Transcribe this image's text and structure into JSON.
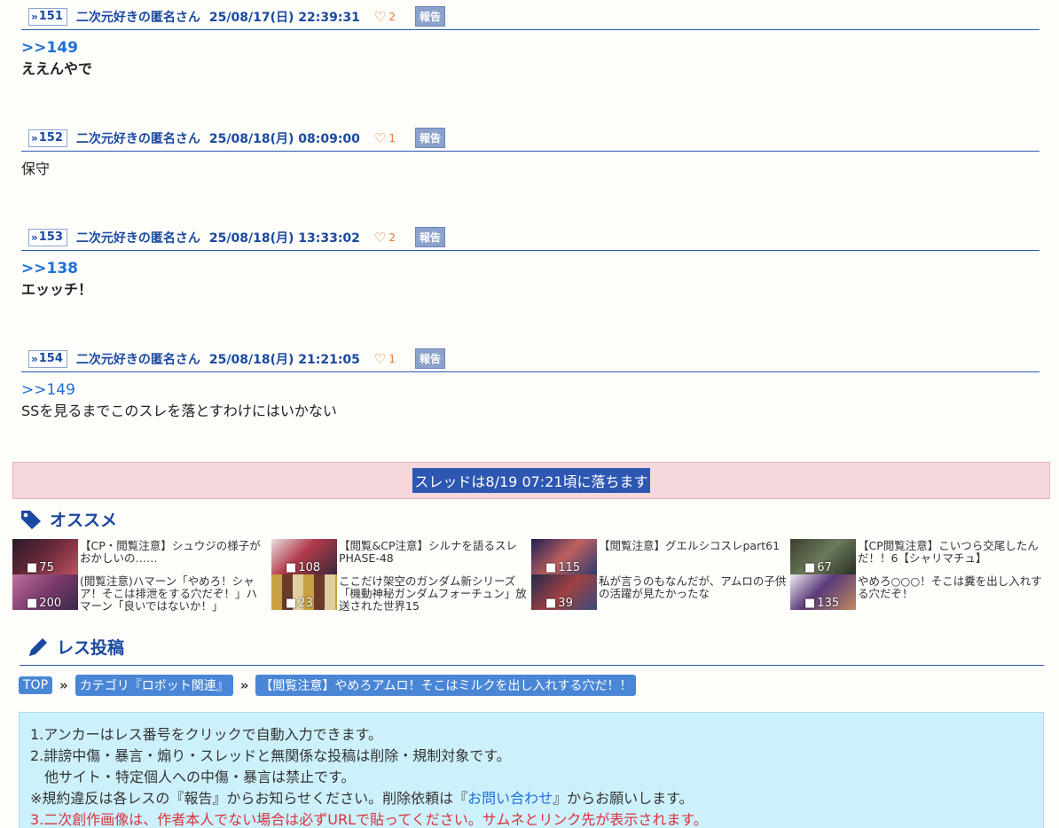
{
  "posts": [
    {
      "num": "151",
      "author": "二次元好きの匿名さん",
      "date": "25/08/17(日) 22:39:31",
      "likes": "2",
      "report": "報告",
      "anchor": ">>149",
      "text": "ええんやで"
    },
    {
      "num": "152",
      "author": "二次元好きの匿名さん",
      "date": "25/08/18(月) 08:09:00",
      "likes": "1",
      "report": "報告",
      "text": "保守"
    },
    {
      "num": "153",
      "author": "二次元好きの匿名さん",
      "date": "25/08/18(月) 13:33:02",
      "likes": "2",
      "report": "報告",
      "anchor": ">>138",
      "text": "エッッチ！"
    },
    {
      "num": "154",
      "author": "二次元好きの匿名さん",
      "date": "25/08/18(月) 21:21:05",
      "likes": "1",
      "report": "報告",
      "anchor": ">>149",
      "text": "SSを見るまでこのスレを落とすわけにはいかない"
    }
  ],
  "thread_end": "スレッドは8/19 07:21頃に落ちます",
  "recommend": {
    "title": "オススメ",
    "items": [
      {
        "count": "75",
        "title": "【CP・閲覧注意】シュウジの様子がおかしいの……",
        "color": "#6b2a3a"
      },
      {
        "count": "108",
        "title": "【閲覧&CP注意】シルナを語るスレPHASE-48",
        "color": "#b33a4a"
      },
      {
        "count": "115",
        "title": "【閲覧注意】グエルシコスレpart61",
        "color": "#2c3a6e"
      },
      {
        "count": "67",
        "title": "【CP閲覧注意】こいつら交尾したんだ！！6【シャリマチュ】",
        "color": "#4a5a3a"
      },
      {
        "count": "200",
        "title": "(閲覧注意)ハマーン「やめろ！シャア！そこは排泄をする穴だぞ！」ハマーン「良いではないか！」",
        "color": "#7a3a6a"
      },
      {
        "count": "23",
        "title": "ここだけ架空のガンダム新シリーズ「機動神秘ガンダムフォーチュン」放送された世界15",
        "color": "#c8a040"
      },
      {
        "count": "39",
        "title": "私が言うのもなんだが、アムロの子供の活躍が見たかったな",
        "color": "#3a4a7a"
      },
      {
        "count": "135",
        "title": "やめろ○○○！そこは糞を出し入れする穴だぞ！",
        "color": "#5a3a7a"
      }
    ]
  },
  "post_form": {
    "title": "レス投稿",
    "breadcrumb": [
      "TOP",
      "カテゴリ『ロボット関連』",
      "【閲覧注意】やめろアムロ！そこはミルクを出し入れする穴だ！！"
    ],
    "notice": {
      "line1": "1.アンカーはレス番号をクリックで自動入力できます。",
      "line2": "2.誹謗中傷・暴言・煽り・スレッドと無関係な投稿は削除・規制対象です。",
      "line2b": "他サイト・特定個人への中傷・暴言は禁止です。",
      "line3_pre": "※規約違反は各レスの『報告』からお知らせください。削除依頼は『",
      "line3_link": "お問い合わせ",
      "line3_post": "』からお願いします。",
      "line4": "3.二次創作画像は、作者本人でない場合は必ずURLで貼ってください。サムネとリンク先が表示されます。"
    }
  },
  "colors": {
    "accent": "#1a49a0",
    "link": "#1e6fd8",
    "like": "#e87a2c",
    "end_bg": "#f6d8dc",
    "notice_bg": "#cdf1fb"
  },
  "icons": {
    "anchor": "double-chevron-icon",
    "like": "heart-icon",
    "recommend": "tag-icon",
    "form": "pencil-icon",
    "comment": "comment-icon",
    "breadcrumb_sep": "double-chevron-right-icon"
  }
}
